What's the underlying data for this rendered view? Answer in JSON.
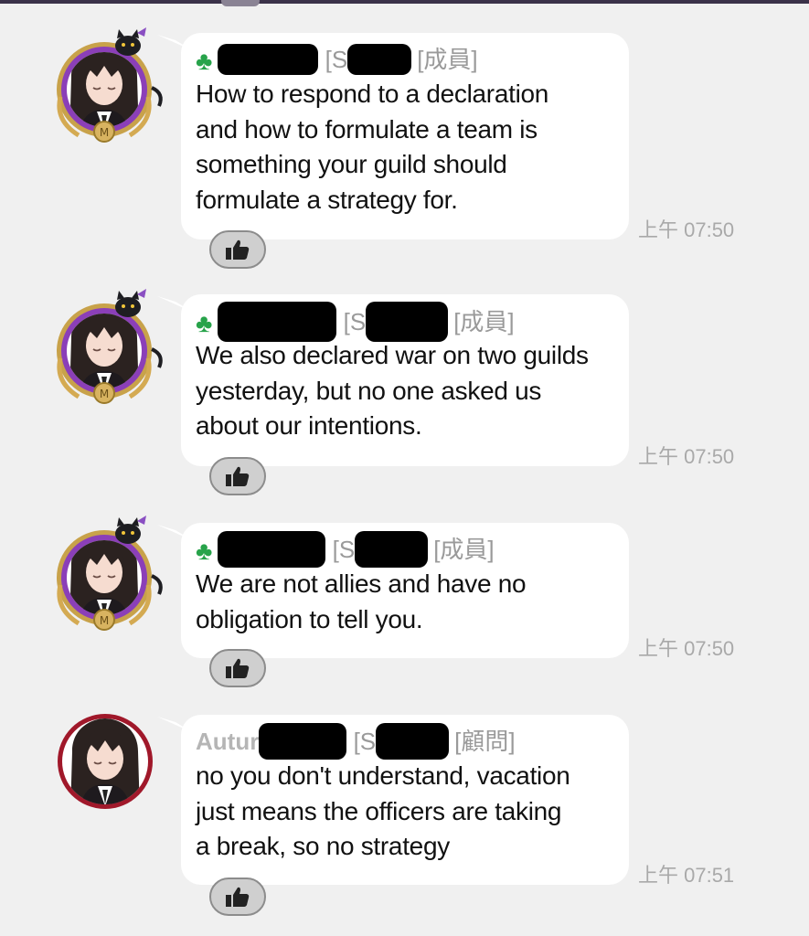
{
  "messages": [
    {
      "name": "",
      "role": "[成員]",
      "text": "How to respond to a declaration\nand how to formulate a team is\nsomething your guild should\nformulate a strategy for.",
      "time": "上午 07:50"
    },
    {
      "name": "",
      "role": "[成員]",
      "text": "We also declared war on two guilds\nyesterday, but no one asked us\nabout our intentions.",
      "time": "上午 07:50"
    },
    {
      "name": "",
      "role": "[成員]",
      "text": "We are not allies and have no\nobligation to tell you.",
      "time": "上午 07:50"
    },
    {
      "name": "Autur",
      "role": "[顧問]",
      "text": "no you don't understand, vacation\njust means the officers are taking\na break, so no strategy",
      "time": "上午 07:51"
    }
  ],
  "icons": {
    "reaction": "thumbs-up-icon",
    "name_prefix": "clover-icon"
  },
  "colors": {
    "bubble": "#ffffff",
    "background": "#f0f0f0",
    "clover": "#27a34a",
    "frame_gold": "#c8a24a",
    "frame_purple": "#8b3fb8",
    "avatar_ring": "#a0182a"
  }
}
